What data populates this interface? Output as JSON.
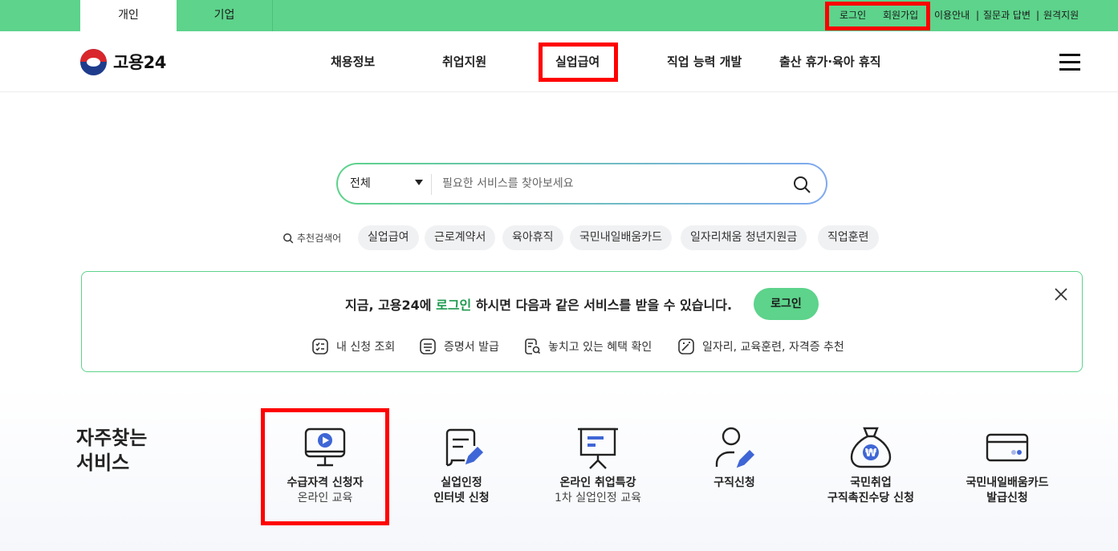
{
  "top_tabs": {
    "personal": "개인",
    "company": "기업"
  },
  "utility": {
    "login": "로그인",
    "join": "회원가입",
    "guide": "이용안내",
    "qa": "질문과 답변",
    "remote": "원격지원",
    "separator": "|"
  },
  "logo": {
    "text": "고용24"
  },
  "nav": {
    "jobs": "채용정보",
    "support": "취업지원",
    "benefit": "실업급여",
    "skill": "직업 능력 개발",
    "leave": "출산 휴가·육아 휴직"
  },
  "search": {
    "scope": "전체",
    "placeholder": "필요한 서비스를 찾아보세요"
  },
  "keywords": {
    "label": "추천검색어",
    "items": [
      "실업급여",
      "근로계약서",
      "육아휴직",
      "국민내일배움카드",
      "일자리채움 청년지원금",
      "직업훈련"
    ]
  },
  "banner": {
    "msg_before": "지금, 고용24에 ",
    "msg_link": "로그인",
    "msg_after": " 하시면 다음과 같은 서비스를 받을 수 있습니다.",
    "login_button": "로그인",
    "benefits": [
      "내 신청 조회",
      "증명서 발급",
      "놓치고 있는 혜택 확인",
      "일자리, 교육훈련, 자격증 추천"
    ]
  },
  "frequent": {
    "title_line1": "자주찾는",
    "title_line2": "서비스",
    "services": [
      {
        "line1": "수급자격 신청자",
        "line2": "온라인 교육"
      },
      {
        "line1": "실업인정",
        "line2": "인터넷 신청"
      },
      {
        "line1": "온라인 취업특강",
        "line2": "1차 실업인정 교육"
      },
      {
        "line1": "구직신청",
        "line2": ""
      },
      {
        "line1": "국민취업",
        "line2": "구직촉진수당 신청"
      },
      {
        "line1": "국민내일배움카드",
        "line2": "발급신청"
      }
    ]
  },
  "colors": {
    "brand_green": "#5dd38b",
    "accent_blue": "#3f66d6",
    "highlight_red": "#ff0000"
  }
}
